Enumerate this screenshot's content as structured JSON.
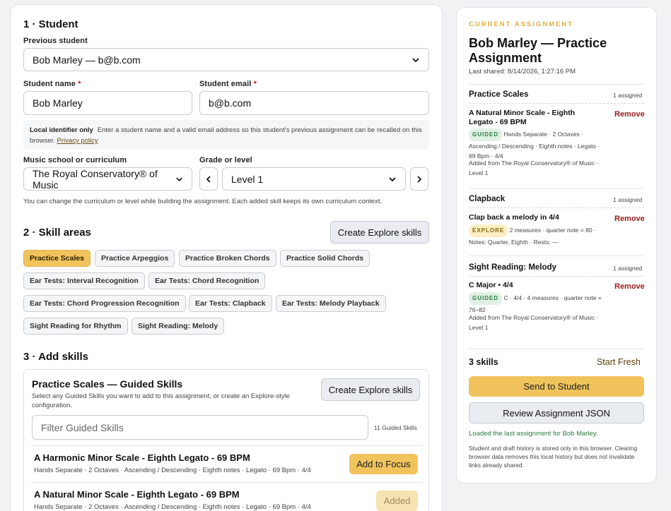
{
  "student": {
    "section_title": "1 · Student",
    "previous_label": "Previous student",
    "previous_value": "Bob Marley — b@b.com",
    "name_label": "Student name",
    "name_value": "Bob Marley",
    "email_label": "Student email",
    "email_value": "b@b.com",
    "required_mark": "*",
    "local_id_label": "Local identifier only",
    "local_id_text": "Enter a student name and a valid email address so this student's previous assignment can be recalled on this browser.",
    "privacy_link": "Privacy policy",
    "curriculum_label": "Music school or curriculum",
    "curriculum_value": "The Royal Conservatory® of Music",
    "grade_label": "Grade or level",
    "grade_value": "Level 1",
    "change_note": "You can change the curriculum or level while building the assignment. Each added skill keeps its own curriculum context."
  },
  "skill_areas": {
    "section_title": "2 · Skill areas",
    "explore_button": "Create Explore skills",
    "chips": [
      "Practice Scales",
      "Practice Arpeggios",
      "Practice Broken Chords",
      "Practice Solid Chords",
      "Ear Tests: Interval Recognition",
      "Ear Tests: Chord Recognition",
      "Ear Tests: Chord Progression Recognition",
      "Ear Tests: Clapback",
      "Ear Tests: Melody Playback",
      "Sight Reading for Rhythm",
      "Sight Reading: Melody"
    ],
    "active_chip": "Practice Scales"
  },
  "add_skills": {
    "section_title": "3 · Add skills",
    "card_title": "Practice Scales — Guided Skills",
    "card_desc": "Select any Guided Skills you want to add to this assignment, or create an Explore-style configuration.",
    "explore_button": "Create Explore skills",
    "filter_placeholder": "Filter Guided Skills",
    "count_text": "11 Guided Skills",
    "skills": [
      {
        "title": "A Harmonic Minor Scale - Eighth Legato - 69 BPM",
        "meta": "Hands Separate · 2 Octaves · Ascending / Descending · Eighth notes · Legato · 69 Bpm · 4/4",
        "action": "Add to Focus"
      },
      {
        "title": "A Natural Minor Scale - Eighth Legato - 69 BPM",
        "meta": "Hands Separate · 2 Octaves · Ascending / Descending · Eighth notes · Legato · 69 Bpm · 4/4",
        "action": "Added"
      }
    ]
  },
  "assignment": {
    "eyebrow": "CURRENT ASSIGNMENT",
    "title": "Bob Marley — Practice Assignment",
    "last_shared": "Last shared: 8/14/2026, 1:27:16 PM",
    "remove_label": "Remove",
    "sections": [
      {
        "name": "Practice Scales",
        "count": "1 assigned",
        "skill": "A Natural Minor Scale - Eighth Legato - 69 BPM",
        "badge": "GUIDED",
        "meta": "Hands Separate · 2 Octaves · Ascending / Descending · Eighth notes · Legato · 69 Bpm · 4/4",
        "source": "Added from The Royal Conservatory® of Music · Level 1"
      },
      {
        "name": "Clapback",
        "count": "1 assigned",
        "skill": "Clap back a melody in 4/4",
        "badge": "EXPLORE",
        "meta": "2 measures · quarter note = 80 · Notes: Quarter, Eighth · Rests: —",
        "source": ""
      },
      {
        "name": "Sight Reading: Melody",
        "count": "1 assigned",
        "skill": "C Major • 4/4",
        "badge": "GUIDED",
        "meta": "C · 4/4 · 4 measures · quarter note = 76–82",
        "source": "Added from The Royal Conservatory® of Music · Level 1"
      }
    ],
    "total": "3 skills",
    "start_fresh": "Start Fresh",
    "send_button": "Send to Student",
    "review_button": "Review Assignment JSON",
    "loaded_msg": "Loaded the last assignment for Bob Marley.",
    "storage_note": "Student and draft history is stored only in this browser. Clearing browser data removes this local history but does not invalidate links already shared."
  },
  "colors": {
    "accent": "#f0c35c",
    "eyebrow": "#e0ae3e",
    "remove": "#9b1c1c",
    "success": "#2b7b3f"
  },
  "icons": {
    "select_chevron": "chevron-down-icon",
    "prev_level": "chevron-left-icon",
    "next_level": "chevron-right-icon"
  }
}
